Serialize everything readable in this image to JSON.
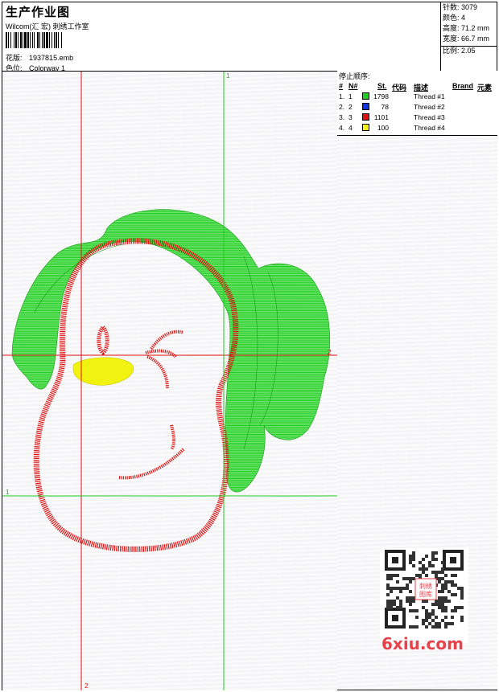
{
  "header": {
    "title": "生产作业图",
    "company": "Wilcom(汇 宏) 刺绣工作室",
    "pattern_label": "花版:",
    "pattern_value": "1937815.emb",
    "colorway_label": "色位:",
    "colorway_value": "Colorway 1"
  },
  "stats": {
    "stitches_label": "针数:",
    "stitches": "3079",
    "colors_label": "颜色:",
    "colors": "4",
    "height_label": "高度:",
    "height": "71.2 mm",
    "width_label": "宽度:",
    "width": "66.7 mm",
    "ratio_label": "比例:",
    "ratio": "2.05"
  },
  "stop_table": {
    "title": "停止顺序:",
    "headers": {
      "num": "#",
      "n": "N#",
      "st": "St.",
      "code": "代码",
      "desc": "描述",
      "brand": "Brand",
      "element": "元素"
    },
    "rows": [
      {
        "num": "1.",
        "n": "1",
        "color": "#22cc22",
        "st": "1798",
        "desc": "Thread #1"
      },
      {
        "num": "2.",
        "n": "2",
        "color": "#1133dd",
        "st": "78",
        "desc": "Thread #2"
      },
      {
        "num": "3.",
        "n": "3",
        "color": "#dd1111",
        "st": "1101",
        "desc": "Thread #3"
      },
      {
        "num": "4.",
        "n": "4",
        "color": "#f2f211",
        "st": "100",
        "desc": "Thread #4"
      }
    ]
  },
  "design": {
    "marker_top": "1",
    "marker_right": "2",
    "marker_left": "1",
    "marker_bottom": "2",
    "green": "#22cc22",
    "red": "#dd1111",
    "yellow": "#f2f211"
  },
  "watermark": {
    "site": "6xiu.com",
    "stamp": "刺绣图库"
  }
}
